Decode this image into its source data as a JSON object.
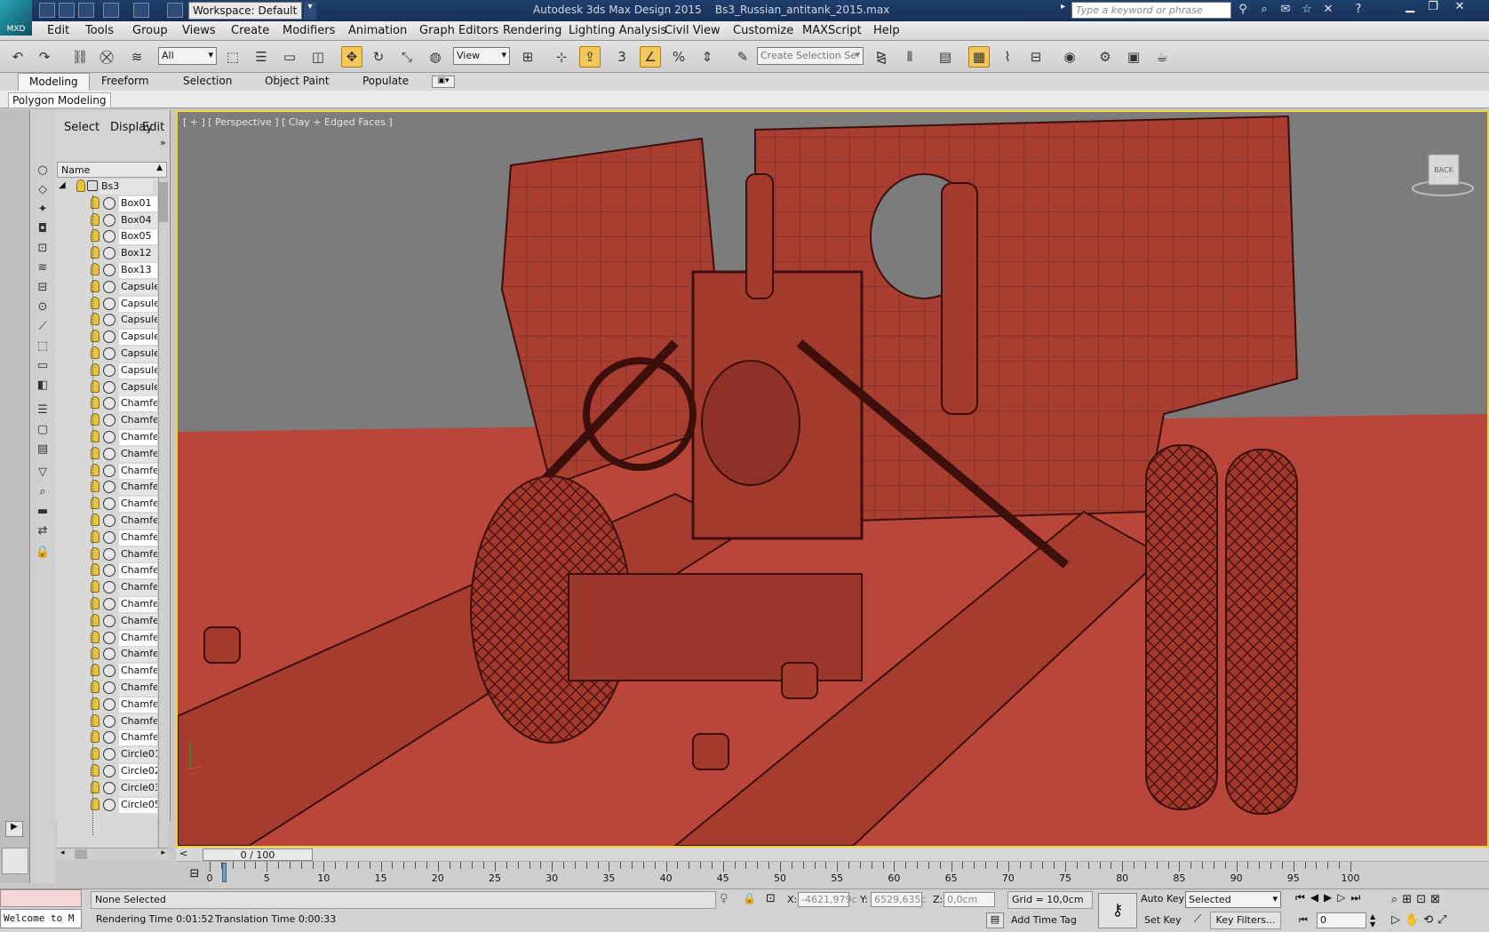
{
  "app": {
    "logo_text": "MXD",
    "workspace": "Workspace: Default",
    "title": "Autodesk 3ds Max Design 2015    Bs3_Russian_antitank_2015.max",
    "search_placeholder": "Type a keyword or phrase"
  },
  "menu": [
    "Edit",
    "Tools",
    "Group",
    "Views",
    "Create",
    "Modifiers",
    "Animation",
    "Graph Editors",
    "Rendering",
    "Lighting Analysis",
    "Civil View",
    "Customize",
    "MAXScript",
    "Help"
  ],
  "toolbar": {
    "filter": "All",
    "refcoord": "View",
    "snap_count": "3",
    "selection_set_placeholder": "Create Selection Se"
  },
  "ribbon": {
    "tabs": [
      "Modeling",
      "Freeform",
      "Selection",
      "Object Paint",
      "Populate"
    ],
    "panel": "Polygon Modeling"
  },
  "explorer": {
    "menus": [
      "Select",
      "Display",
      "Edit"
    ],
    "column": "Name",
    "root": "Bs3",
    "items": [
      "Box01",
      "Box04",
      "Box05",
      "Box12",
      "Box13",
      "Capsule",
      "Capsule",
      "Capsule",
      "Capsule",
      "Capsule",
      "Capsule",
      "Capsule",
      "Chamfe",
      "Chamfe",
      "Chamfe",
      "Chamfe",
      "Chamfe",
      "Chamfe",
      "Chamfe",
      "Chamfe",
      "Chamfe",
      "Chamfe",
      "Chamfe",
      "Chamfe",
      "Chamfe",
      "Chamfe",
      "Chamfe",
      "Chamfe",
      "Chamfe",
      "Chamfe",
      "Chamfe",
      "Chamfe",
      "Chamfe",
      "Circle01",
      "Circle02",
      "Circle03",
      "Circle05"
    ]
  },
  "viewport": {
    "label": "[ + ] [ Perspective ] [ Clay + Edged Faces ]",
    "viewcube": "BACK"
  },
  "timeline": {
    "slider": "0 / 100",
    "ticks": [
      0,
      5,
      10,
      15,
      20,
      25,
      30,
      35,
      40,
      45,
      50,
      55,
      60,
      65,
      70,
      75,
      80,
      85,
      90,
      95,
      100
    ],
    "current_frame": 0,
    "max_frame": 100
  },
  "status": {
    "listener": "Welcome to M",
    "selection": "None Selected",
    "render_time": "Rendering Time  0:01:52",
    "translation_time": "Translation Time  0:00:33",
    "x_label": "X:",
    "x_value": "-4621,979c",
    "y_label": "Y:",
    "y_value": "6529,635c",
    "z_label": "Z:",
    "z_value": "0,0cm",
    "grid": "Grid = 10,0cm",
    "add_time_tag": "Add Time Tag",
    "auto_key": "Auto Key",
    "set_key": "Set Key",
    "key_mode": "Selected",
    "key_filters": "Key Filters...",
    "frame": "0"
  },
  "colors": {
    "accent": "#f4c75a",
    "viewport_border": "#f0d33b",
    "clay": "#b6473a"
  }
}
